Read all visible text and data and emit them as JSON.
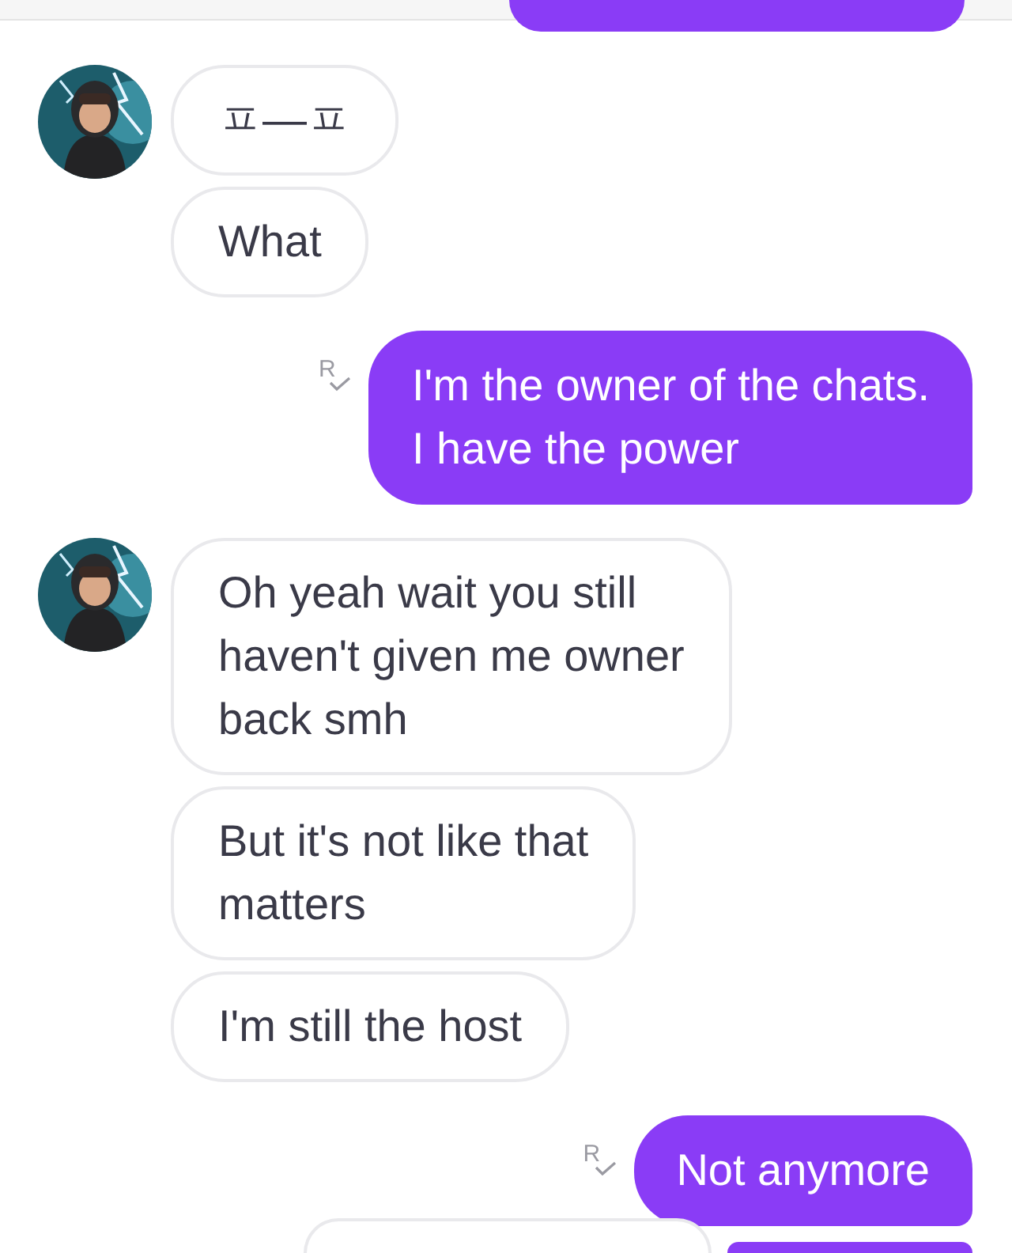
{
  "top_partial": {
    "kind": "outgoing"
  },
  "messages": [
    {
      "kind": "incoming_group",
      "bubbles": [
        {
          "text": "ㅍ—ㅍ"
        },
        {
          "text": "What"
        }
      ]
    },
    {
      "kind": "outgoing",
      "receipt": "R",
      "text": "I'm the owner of the chats.\nI have the power"
    },
    {
      "kind": "incoming_group",
      "bubbles": [
        {
          "text": "Oh yeah wait you still\nhaven't given me owner\nback smh"
        },
        {
          "text": "But it's not like that\nmatters"
        },
        {
          "text": "I'm still the host"
        }
      ]
    },
    {
      "kind": "outgoing",
      "receipt": "R",
      "text": "Not anymore"
    }
  ],
  "bottom_partials": [
    {
      "kind": "incoming"
    },
    {
      "kind": "outgoing"
    }
  ]
}
